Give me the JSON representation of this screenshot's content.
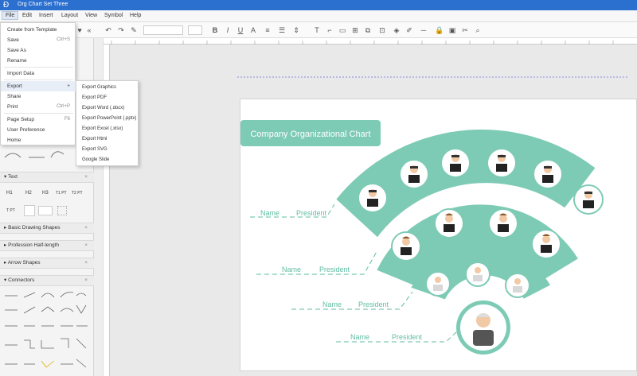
{
  "window": {
    "title": "Org Chart Set Three"
  },
  "menubar": {
    "items": [
      "File",
      "Edit",
      "Insert",
      "Layout",
      "View",
      "Symbol",
      "Help"
    ]
  },
  "toolbar": {
    "font_size": ""
  },
  "file_menu": {
    "items": [
      {
        "label": "Create from Template",
        "shortcut": ""
      },
      {
        "label": "Save",
        "shortcut": "Ctrl+S"
      },
      {
        "label": "Save As",
        "shortcut": ""
      },
      {
        "label": "Rename",
        "shortcut": ""
      },
      {
        "label": "Import Data",
        "shortcut": ""
      },
      {
        "label": "Export",
        "shortcut": "▸"
      },
      {
        "label": "Share",
        "shortcut": ""
      },
      {
        "label": "Print",
        "shortcut": "Ctrl+P"
      },
      {
        "label": "Page Setup",
        "shortcut": "F6"
      },
      {
        "label": "User Preference",
        "shortcut": ""
      },
      {
        "label": "Home",
        "shortcut": ""
      }
    ]
  },
  "export_menu": {
    "items": [
      "Export Graphics",
      "Export PDF",
      "Export Word (.docx)",
      "Export PowerPoint (.pptx)",
      "Export Excel (.xlsx)",
      "Export Html",
      "Export SVG",
      "Google Slide"
    ]
  },
  "sidebar": {
    "panels": [
      {
        "label": "Text"
      },
      {
        "label": "Basic Drawing Shapes"
      },
      {
        "label": "Profession Half-length"
      },
      {
        "label": "Arrow Shapes"
      },
      {
        "label": "Connectors"
      }
    ],
    "text_samples": [
      "H1",
      "H2",
      "H3",
      "T1 PT",
      "T2 PT",
      "T PT"
    ],
    "close_symbol": "×"
  },
  "chart": {
    "title": "Company Organizational Chart",
    "rows": [
      {
        "name": "Name",
        "role": "President"
      },
      {
        "name": "Name",
        "role": "President"
      },
      {
        "name": "Name",
        "role": "President"
      },
      {
        "name": "Name",
        "role": "President"
      }
    ],
    "colors": {
      "accent": "#7ecbb5",
      "line": "#5fbda2",
      "text": "#5fbda2"
    }
  },
  "colors": {
    "titlebar": "#2b6fcf",
    "menu_highlight": "#e8eef8"
  }
}
